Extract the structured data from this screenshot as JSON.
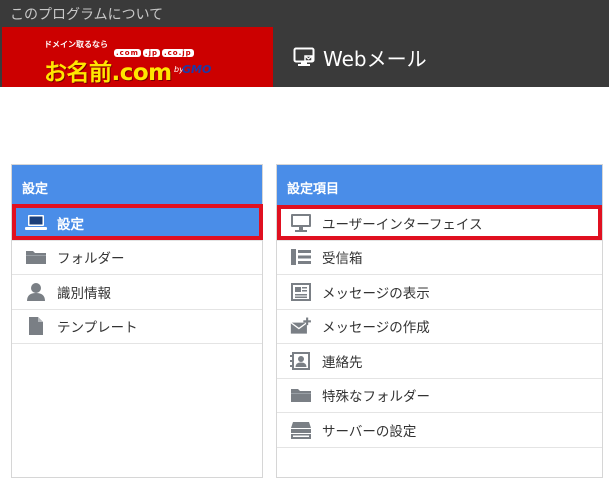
{
  "window": {
    "title": "このプログラムについて"
  },
  "header": {
    "logo": {
      "tagline": "ドメイン取るなら",
      "domains": [
        ".com",
        ".jp",
        ".co.jp"
      ],
      "name": "お名前.com",
      "by": "by",
      "company": "GMO"
    },
    "app_title": "Webメール",
    "icon": "webmail-monitor-icon"
  },
  "left_panel": {
    "title": "設定",
    "items": [
      {
        "label": "設定",
        "icon": "laptop-icon",
        "active": true
      },
      {
        "label": "フォルダー",
        "icon": "folder-icon",
        "active": false
      },
      {
        "label": "識別情報",
        "icon": "person-icon",
        "active": false
      },
      {
        "label": "テンプレート",
        "icon": "document-icon",
        "active": false
      }
    ]
  },
  "right_panel": {
    "title": "設定項目",
    "items": [
      {
        "label": "ユーザーインターフェイス",
        "icon": "monitor-icon"
      },
      {
        "label": "受信箱",
        "icon": "inbox-list-icon"
      },
      {
        "label": "メッセージの表示",
        "icon": "message-view-icon"
      },
      {
        "label": "メッセージの作成",
        "icon": "compose-envelope-icon"
      },
      {
        "label": "連絡先",
        "icon": "contact-card-icon"
      },
      {
        "label": "特殊なフォルダー",
        "icon": "folder-icon"
      },
      {
        "label": "サーバーの設定",
        "icon": "server-icon"
      }
    ]
  },
  "colors": {
    "topbar": "#3a3a3a",
    "brand_red": "#cc0000",
    "panel_header": "#4a8de8",
    "highlight_box": "#e01020",
    "icon_gray": "#7a7f85"
  }
}
